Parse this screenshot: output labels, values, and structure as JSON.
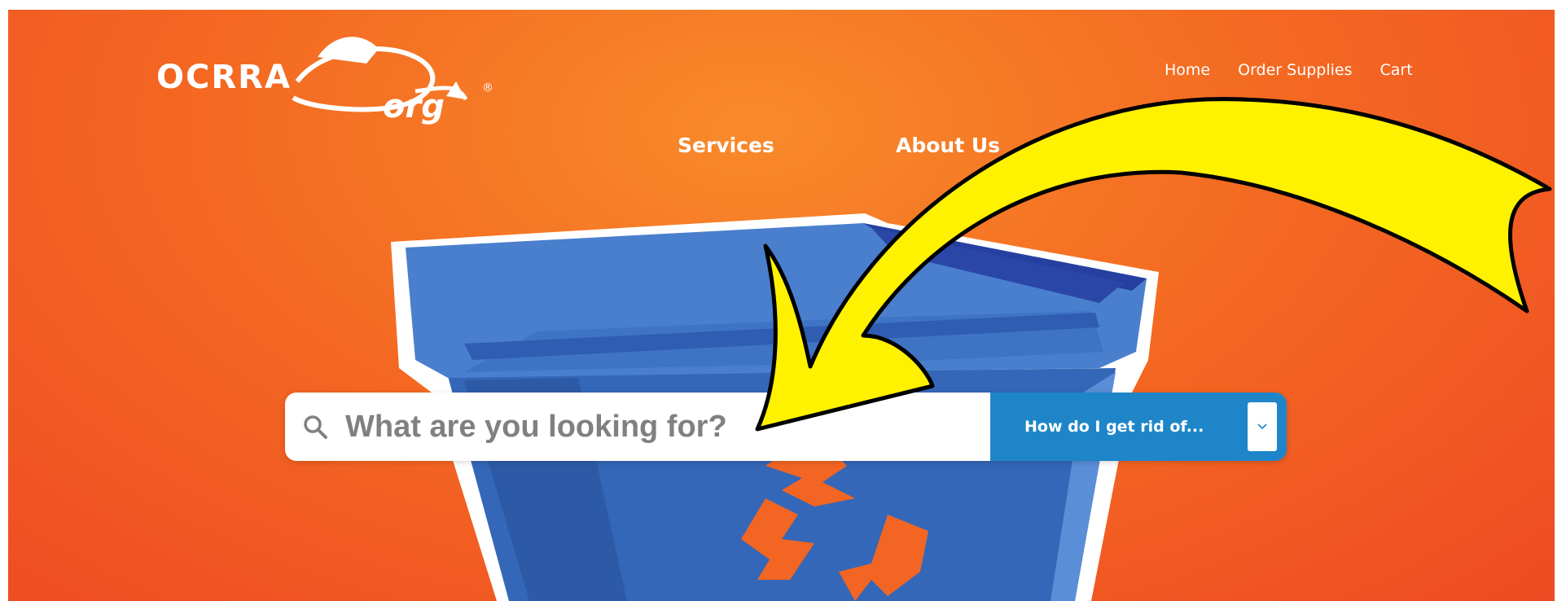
{
  "logo": {
    "brand": "OCRRA",
    "suffix": "org",
    "registered": "®"
  },
  "top_nav": {
    "home": "Home",
    "order_supplies": "Order Supplies",
    "cart": "Cart"
  },
  "main_nav": {
    "services": "Services",
    "about_us": "About Us"
  },
  "search": {
    "placeholder": "What are you looking for?",
    "dropdown_label": "How do I get rid of...",
    "dropdown_icon": "chevron-down-icon"
  },
  "colors": {
    "background_orange": "#f46a22",
    "bin_blue": "#3a6fc4",
    "search_blue": "#1e86c8",
    "arrow_yellow": "#fff200",
    "recycle_orange": "#f26522"
  }
}
